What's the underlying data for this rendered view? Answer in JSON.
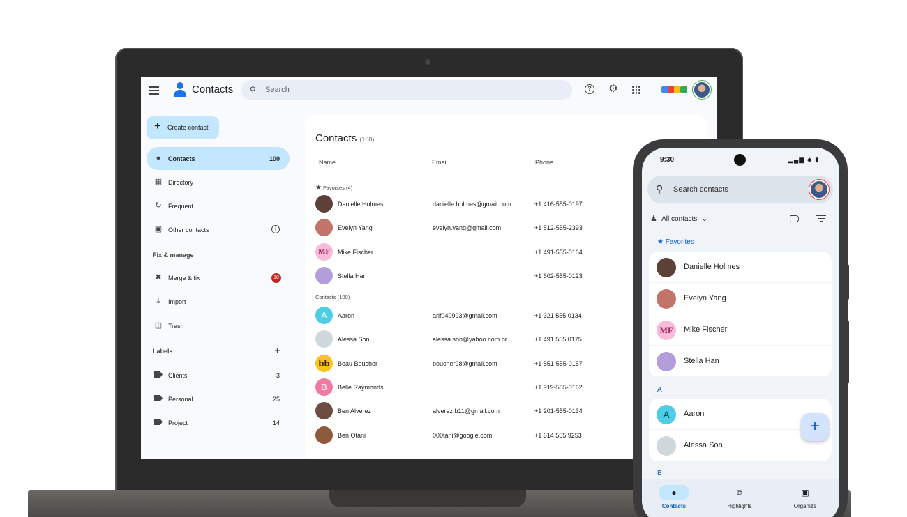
{
  "colors": {
    "accent": "#c2e7ff",
    "primary": "#0b57d0",
    "badge": "#c5221f",
    "surface": "#f8fafd"
  },
  "desktop": {
    "app_title": "Contacts",
    "search_placeholder": "Search",
    "toolbar_icons": [
      "help-icon",
      "gear-icon",
      "apps-grid-icon"
    ],
    "create_label": "Create contact",
    "nav": [
      {
        "label": "Contacts",
        "count": "100",
        "icon": "person-icon"
      },
      {
        "label": "Directory",
        "icon": "building-icon"
      },
      {
        "label": "Frequent",
        "icon": "history-icon"
      },
      {
        "label": "Other contacts",
        "icon": "archive-icon"
      }
    ],
    "fix_manage_header": "Fix & manage",
    "fix_items": [
      {
        "label": "Merge & fix",
        "badge": "10",
        "icon": "merge-icon"
      },
      {
        "label": "Import",
        "icon": "download-icon"
      },
      {
        "label": "Trash",
        "icon": "trash-icon"
      }
    ],
    "labels_header": "Labels",
    "labels": [
      {
        "label": "Clients",
        "count": "3"
      },
      {
        "label": "Personal",
        "count": "25"
      },
      {
        "label": "Project",
        "count": "14"
      }
    ],
    "list_title": "Contacts",
    "list_count": "(100)",
    "columns": {
      "name": "Name",
      "email": "Email",
      "phone": "Phone"
    },
    "favorites_header": "Favorites (4)",
    "favorites": [
      {
        "name": "Danielle Holmes",
        "email": "danielle.holmes@gmail.com",
        "phone": "+1 416-555-0197",
        "initials": "",
        "color": "#5d4037"
      },
      {
        "name": "Evelyn Yang",
        "email": "evelyn.yang@gmail.com",
        "phone": "+1 512-555-2393",
        "initials": "",
        "color": "#c2746a"
      },
      {
        "name": "Mike Fischer",
        "email": "",
        "phone": "+1 491-555-0164",
        "initials": "MF",
        "color": "#f8bbd9"
      },
      {
        "name": "Stella Han",
        "email": "",
        "phone": "+1 602-555-0123",
        "initials": "",
        "color": "#b39ddb"
      }
    ],
    "contacts_header": "Contacts (100)",
    "contacts": [
      {
        "name": "Aaron",
        "email": "arif040993@gmail.com",
        "phone": "+1 321 555 0134",
        "initials": "A",
        "color": "#4ecde6"
      },
      {
        "name": "Alessa Son",
        "email": "alessa.son@yahoo.com.br",
        "phone": "+1 491 555 0175",
        "initials": "",
        "color": "#cfd8dc"
      },
      {
        "name": "Beau Boucher",
        "email": "boucher98@gmail.com",
        "phone": "+1  551-555-0157",
        "initials": "bb",
        "color": "#f9c41a"
      },
      {
        "name": "Belle Raymonds",
        "email": "",
        "phone": "+1  919-555-0162",
        "initials": "B",
        "color": "#f27ba3"
      },
      {
        "name": "Ben Alverez",
        "email": "alverez.b11@gmail.com",
        "phone": "+1  201-555-0134",
        "initials": "",
        "color": "#6d4c41"
      },
      {
        "name": "Ben Otani",
        "email": "000tani@google.com",
        "phone": "+1 614 555 9253",
        "initials": "",
        "color": "#8d5a3b"
      }
    ]
  },
  "mobile": {
    "time": "9:30",
    "status_icons": "▂▄▆ ◆ ▮",
    "search_placeholder": "Search contacts",
    "filter_label": "All contacts",
    "favorites_header": "Favorites",
    "favorites": [
      {
        "name": "Danielle Holmes",
        "initials": "",
        "color": "#5d4037"
      },
      {
        "name": "Evelyn Yang",
        "initials": "",
        "color": "#c2746a"
      },
      {
        "name": "Mike Fischer",
        "initials": "MF",
        "color": "#f8bbd9"
      },
      {
        "name": "Stella Han",
        "initials": "",
        "color": "#b39ddb"
      }
    ],
    "section_a": "A",
    "a_contacts": [
      {
        "name": "Aaron",
        "initials": "A",
        "color": "#4ecde6"
      },
      {
        "name": "Alessa Son",
        "initials": "",
        "color": "#cfd8dc"
      }
    ],
    "section_b": "B",
    "nav": [
      {
        "label": "Contacts",
        "icon": "person-icon"
      },
      {
        "label": "Highlights",
        "icon": "highlights-icon"
      },
      {
        "label": "Organize",
        "icon": "bookmark-icon"
      }
    ]
  }
}
